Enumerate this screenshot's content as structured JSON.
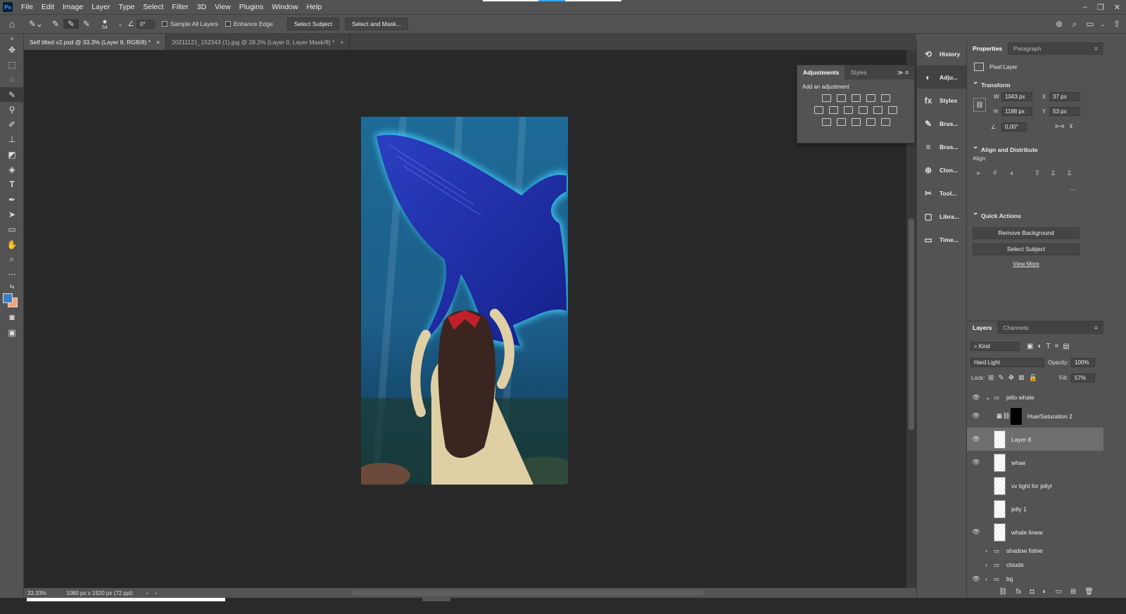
{
  "app": {
    "logo": "Ps"
  },
  "menu": [
    "File",
    "Edit",
    "Image",
    "Layer",
    "Type",
    "Select",
    "Filter",
    "3D",
    "View",
    "Plugins",
    "Window",
    "Help"
  ],
  "options": {
    "brush_size": "54",
    "angle": "0°",
    "sample_all_layers": "Sample All Layers",
    "enhance_edge": "Enhance Edge",
    "select_subject": "Select Subject",
    "select_and_mask": "Select and Mask..."
  },
  "tabs": [
    {
      "label": "Self tilted v2.psd @ 33.3% (Layer 8, RGB/8) *",
      "close": "×"
    },
    {
      "label": "20211121_152343 (1).jpg @ 28.2% (Layer 0, Layer Mask/8) *",
      "close": "×"
    }
  ],
  "status": {
    "zoom": "33.33%",
    "doc_info": "1080 px x 1920 px (72 ppi)"
  },
  "adjustments": {
    "tab_active": "Adjustments",
    "tab_other": "Styles",
    "add_label": "Add an adjustment"
  },
  "dock": [
    {
      "label": "History",
      "icon": "history-icon",
      "glyph": "⟲"
    },
    {
      "label": "Adju...",
      "icon": "adjustments-icon",
      "glyph": "◐"
    },
    {
      "label": "Styles",
      "icon": "styles-icon",
      "glyph": "fx"
    },
    {
      "label": "Brus...",
      "icon": "brush-icon",
      "glyph": "✎"
    },
    {
      "label": "Brus...",
      "icon": "brush-settings-icon",
      "glyph": "≡"
    },
    {
      "label": "Clon...",
      "icon": "clone-source-icon",
      "glyph": "⊕"
    },
    {
      "label": "Tool...",
      "icon": "tool-presets-icon",
      "glyph": "✂"
    },
    {
      "label": "Libra...",
      "icon": "libraries-icon",
      "glyph": "▢"
    },
    {
      "label": "Time...",
      "icon": "timeline-icon",
      "glyph": "▭"
    }
  ],
  "properties": {
    "tab_active": "Properties",
    "tab_other": "Paragraph",
    "kind": "Pixel Layer",
    "transform": "Transform",
    "w_label": "W",
    "w": "1043 px",
    "x_label": "X",
    "x": "37 px",
    "h_label": "H",
    "h": "1198 px",
    "y_label": "Y",
    "y": "53 px",
    "angle": "0.00°",
    "align_distribute": "Align and Distribute",
    "align": "Align:",
    "quick_actions": "Quick Actions",
    "remove_bg": "Remove Background",
    "select_subject": "Select Subject",
    "view_more": "View More"
  },
  "layers": {
    "tab_active": "Layers",
    "tab_other": "Channels",
    "kind": "Kind",
    "blend": "Hard Light",
    "opacity_label": "Opacity:",
    "opacity": "100%",
    "lock_label": "Lock:",
    "fill_label": "Fill:",
    "fill": "57%",
    "items": [
      {
        "name": "jello whale",
        "type": "group-open",
        "visible": true
      },
      {
        "name": "Hue/Saturation 2",
        "type": "adjustment",
        "visible": true
      },
      {
        "name": "Layer 8",
        "type": "pixel",
        "visible": true,
        "selected": true
      },
      {
        "name": "whae",
        "type": "pixel",
        "visible": true
      },
      {
        "name": "vv light for jellyl",
        "type": "pixel",
        "visible": false
      },
      {
        "name": "jelly 1",
        "type": "pixel",
        "visible": false
      },
      {
        "name": "whale linear",
        "type": "pixel",
        "visible": true
      },
      {
        "name": "shadow fishie",
        "type": "group",
        "visible": false
      },
      {
        "name": "clouds",
        "type": "group",
        "visible": false
      },
      {
        "name": "bg",
        "type": "group",
        "visible": true
      }
    ]
  },
  "colors": {
    "foreground": "#3d7fc2",
    "background": "#f4a17a",
    "accent": "#31a8ff"
  }
}
